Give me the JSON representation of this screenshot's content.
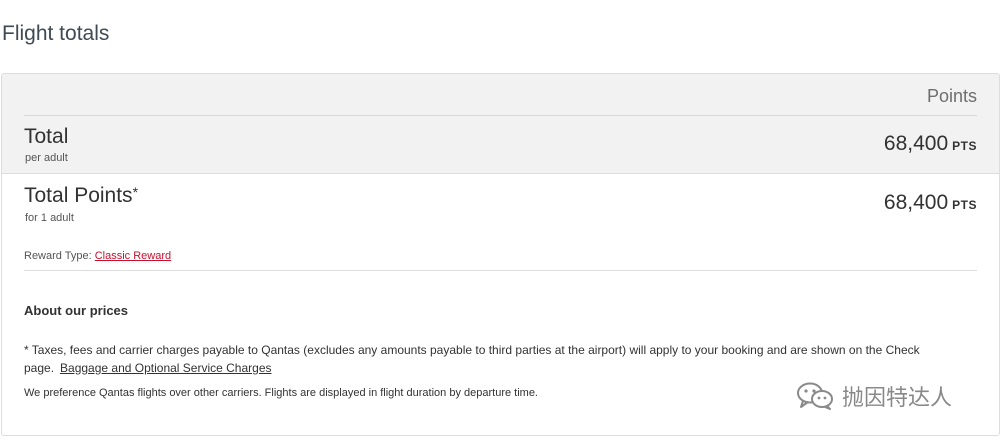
{
  "page": {
    "title": "Flight totals"
  },
  "table": {
    "column_header": "Points",
    "total": {
      "label": "Total",
      "sublabel": "per adult",
      "amount": "68,400",
      "unit": "PTS"
    },
    "total_points": {
      "label": "Total Points",
      "star": "*",
      "sublabel": "for 1 adult",
      "amount": "68,400",
      "unit": "PTS"
    },
    "reward": {
      "label": "Reward Type:",
      "value": "Classic Reward"
    }
  },
  "about": {
    "title": "About our prices",
    "note": "* Taxes, fees and carrier charges payable to Qantas (excludes any amounts payable to third parties at the airport) will apply to your booking and are shown on the Check page.",
    "link": "Baggage and Optional Service Charges",
    "preference": "We preference Qantas flights over other carriers.  Flights are displayed in flight duration by departure time."
  },
  "watermark": {
    "icon": "wechat-icon",
    "text": "抛因特达人"
  },
  "colors": {
    "link_red": "#c8102e",
    "header_bg": "#f2f2f2",
    "title": "#3f4a54"
  }
}
